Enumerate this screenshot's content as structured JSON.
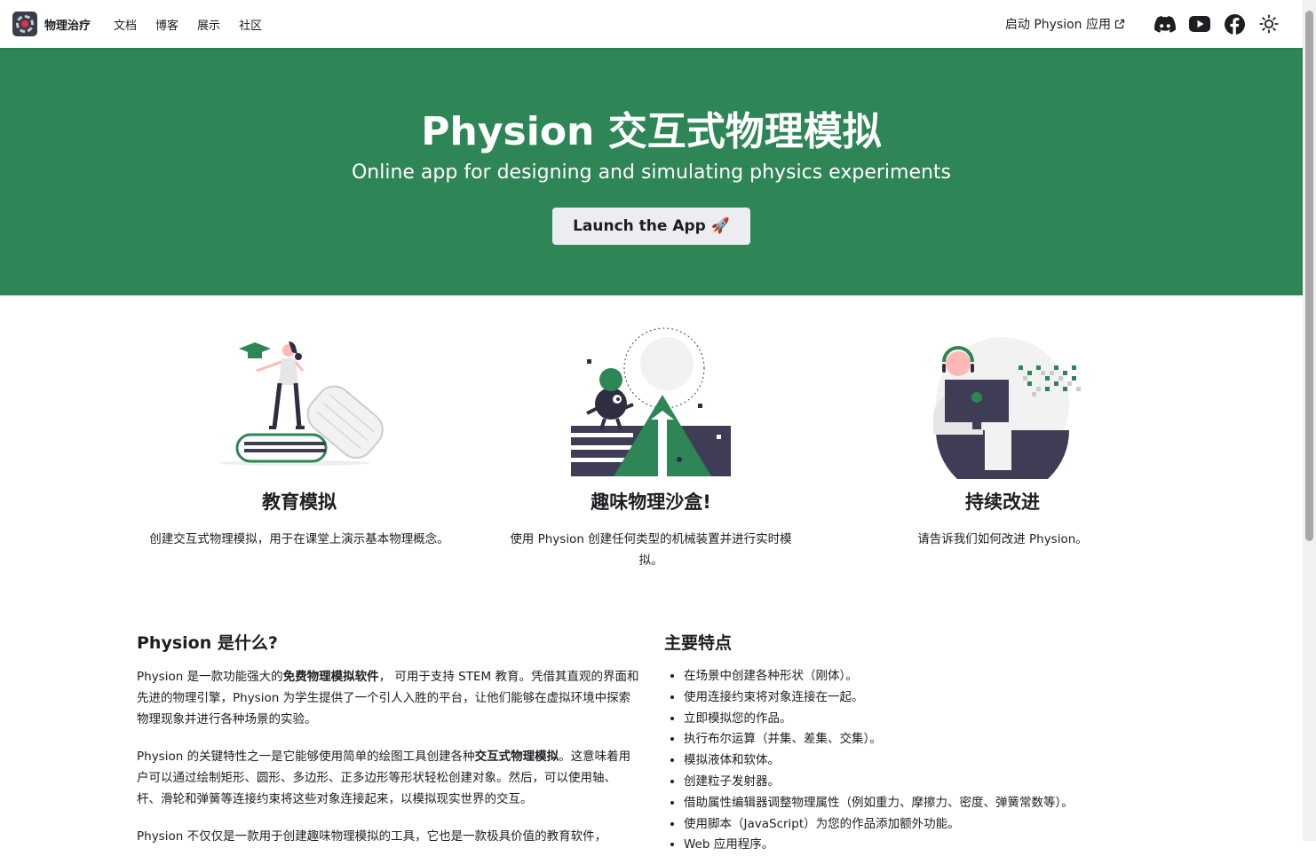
{
  "navbar": {
    "brand": "物理治疗",
    "links": [
      "文档",
      "博客",
      "展示",
      "社区"
    ],
    "launch_link": "启动 Physion 应用",
    "icons": [
      "discord-icon",
      "youtube-icon",
      "facebook-icon",
      "theme-toggle-icon"
    ]
  },
  "hero": {
    "title": "Physion 交互式物理模拟",
    "subtitle": "Online app for designing and simulating physics experiments",
    "button": "Launch the App 🚀"
  },
  "features": [
    {
      "title": "教育模拟",
      "description": "创建交互式物理模拟，用于在课堂上演示基本物理概念。"
    },
    {
      "title": "趣味物理沙盒!",
      "description": "使用 Physion 创建任何类型的机械装置并进行实时模拟。"
    },
    {
      "title": "持续改进",
      "description": "请告诉我们如何改进 Physion。"
    }
  ],
  "what_is": {
    "heading": "Physion 是什么?",
    "p1_a": "Physion 是一款功能强大的",
    "p1_bold": "免费物理模拟软件",
    "p1_b": "， 可用于支持 STEM 教育。凭借其直观的界面和先进的物理引擎，Physion 为学生提供了一个引人入胜的平台，让他们能够在虚拟环境中探索物理现象并进行各种场景的实验。",
    "p2_a": "Physion 的关键特性之一是它能够使用简单的绘图工具创建各种",
    "p2_bold": "交互式物理模拟",
    "p2_b": "。这意味着用户可以通过绘制矩形、圆形、多边形、正多边形等形状轻松创建对象。然后，可以使用轴、杆、滑轮和弹簧等连接约束将这些对象连接起来，以模拟现实世界的交互。",
    "p3": "Physion 不仅仅是一款用于创建趣味物理模拟的工具，它也是一款极具价值的教育软件，"
  },
  "key_features": {
    "heading": "主要特点",
    "items": [
      "在场景中创建各种形状（刚体）。",
      "使用连接约束将对象连接在一起。",
      "立即模拟您的作品。",
      "执行布尔运算（并集、差集、交集）。",
      "模拟液体和软体。",
      "创建粒子发射器。",
      "借助属性编辑器调整物理属性（例如重力、摩擦力、密度、弹簧常数等）。",
      "使用脚本（JavaScript）为您的作品添加额外功能。",
      "Web 应用程序。"
    ]
  },
  "colors": {
    "hero_bg": "#2e8555",
    "button_bg": "#ebedf0",
    "text": "#1c1e21"
  }
}
